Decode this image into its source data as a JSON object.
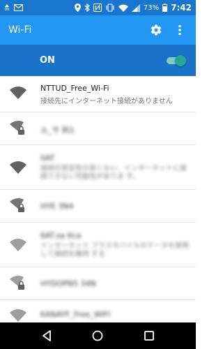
{
  "status_bar": {
    "left_small_text": "0k",
    "battery_percent": "73%",
    "time": "7:42",
    "icons": [
      "data-rate-icon",
      "mail-icon",
      "location-icon",
      "bluetooth-icon",
      "nfc-icon",
      "vibrate-icon",
      "wifi-icon",
      "signal-icon",
      "battery-icon"
    ]
  },
  "app_bar": {
    "title": "Wi-Fi",
    "actions": [
      "settings-icon",
      "overflow-menu-icon"
    ]
  },
  "wifi_switch": {
    "label": "ON",
    "state": "on"
  },
  "networks": [
    {
      "name": "NTTUD_Free_Wi-Fi",
      "status": "接続先にインターネット接続がありません",
      "secured": false,
      "blurred": false
    },
    {
      "name": "ル_サ 利1",
      "status": "",
      "secured": true,
      "blurred": true
    },
    {
      "name": "0AT",
      "status": "接続の安定性が高くない、インターネットに接続できない可能性がありま す。",
      "secured": false,
      "blurred": true
    },
    {
      "name": "HYE 3N4",
      "status": "",
      "secured": true,
      "blurred": true
    },
    {
      "name": "6AT.sa 6ca",
      "status": "インターネット プラスモバイルのデータを使用して接続を維持 する",
      "secured": false,
      "blurred": true
    },
    {
      "name": "HYDOPN5 34N",
      "status": "",
      "secured": true,
      "blurred": true
    },
    {
      "name": "KANAYF_Free_WIFI",
      "status": "",
      "secured": false,
      "blurred": true
    }
  ],
  "nav_bar": {
    "buttons": [
      "back-icon",
      "home-icon",
      "recents-icon"
    ]
  },
  "colors": {
    "status_bar": "#1976cf",
    "app_bar": "#2196f3",
    "switch_bar": "#1a73c9",
    "toggle_on": "#26a69a"
  }
}
